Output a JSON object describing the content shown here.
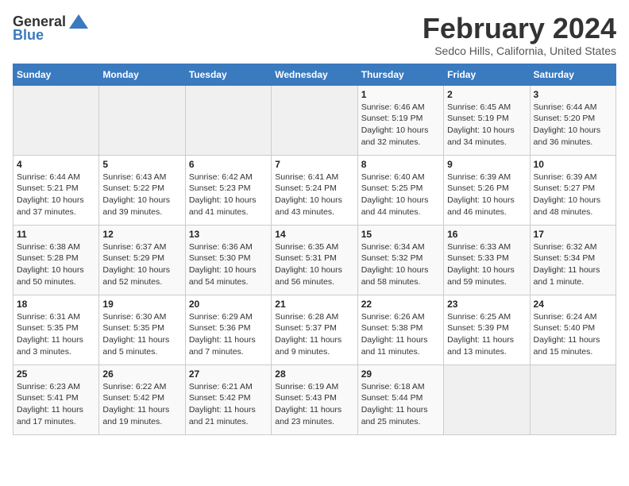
{
  "header": {
    "logo_general": "General",
    "logo_blue": "Blue",
    "month_title": "February 2024",
    "location": "Sedco Hills, California, United States"
  },
  "weekdays": [
    "Sunday",
    "Monday",
    "Tuesday",
    "Wednesday",
    "Thursday",
    "Friday",
    "Saturday"
  ],
  "weeks": [
    [
      {
        "day": "",
        "sunrise": "",
        "sunset": "",
        "daylight": ""
      },
      {
        "day": "",
        "sunrise": "",
        "sunset": "",
        "daylight": ""
      },
      {
        "day": "",
        "sunrise": "",
        "sunset": "",
        "daylight": ""
      },
      {
        "day": "",
        "sunrise": "",
        "sunset": "",
        "daylight": ""
      },
      {
        "day": "1",
        "sunrise": "Sunrise: 6:46 AM",
        "sunset": "Sunset: 5:19 PM",
        "daylight": "Daylight: 10 hours and 32 minutes."
      },
      {
        "day": "2",
        "sunrise": "Sunrise: 6:45 AM",
        "sunset": "Sunset: 5:19 PM",
        "daylight": "Daylight: 10 hours and 34 minutes."
      },
      {
        "day": "3",
        "sunrise": "Sunrise: 6:44 AM",
        "sunset": "Sunset: 5:20 PM",
        "daylight": "Daylight: 10 hours and 36 minutes."
      }
    ],
    [
      {
        "day": "4",
        "sunrise": "Sunrise: 6:44 AM",
        "sunset": "Sunset: 5:21 PM",
        "daylight": "Daylight: 10 hours and 37 minutes."
      },
      {
        "day": "5",
        "sunrise": "Sunrise: 6:43 AM",
        "sunset": "Sunset: 5:22 PM",
        "daylight": "Daylight: 10 hours and 39 minutes."
      },
      {
        "day": "6",
        "sunrise": "Sunrise: 6:42 AM",
        "sunset": "Sunset: 5:23 PM",
        "daylight": "Daylight: 10 hours and 41 minutes."
      },
      {
        "day": "7",
        "sunrise": "Sunrise: 6:41 AM",
        "sunset": "Sunset: 5:24 PM",
        "daylight": "Daylight: 10 hours and 43 minutes."
      },
      {
        "day": "8",
        "sunrise": "Sunrise: 6:40 AM",
        "sunset": "Sunset: 5:25 PM",
        "daylight": "Daylight: 10 hours and 44 minutes."
      },
      {
        "day": "9",
        "sunrise": "Sunrise: 6:39 AM",
        "sunset": "Sunset: 5:26 PM",
        "daylight": "Daylight: 10 hours and 46 minutes."
      },
      {
        "day": "10",
        "sunrise": "Sunrise: 6:39 AM",
        "sunset": "Sunset: 5:27 PM",
        "daylight": "Daylight: 10 hours and 48 minutes."
      }
    ],
    [
      {
        "day": "11",
        "sunrise": "Sunrise: 6:38 AM",
        "sunset": "Sunset: 5:28 PM",
        "daylight": "Daylight: 10 hours and 50 minutes."
      },
      {
        "day": "12",
        "sunrise": "Sunrise: 6:37 AM",
        "sunset": "Sunset: 5:29 PM",
        "daylight": "Daylight: 10 hours and 52 minutes."
      },
      {
        "day": "13",
        "sunrise": "Sunrise: 6:36 AM",
        "sunset": "Sunset: 5:30 PM",
        "daylight": "Daylight: 10 hours and 54 minutes."
      },
      {
        "day": "14",
        "sunrise": "Sunrise: 6:35 AM",
        "sunset": "Sunset: 5:31 PM",
        "daylight": "Daylight: 10 hours and 56 minutes."
      },
      {
        "day": "15",
        "sunrise": "Sunrise: 6:34 AM",
        "sunset": "Sunset: 5:32 PM",
        "daylight": "Daylight: 10 hours and 58 minutes."
      },
      {
        "day": "16",
        "sunrise": "Sunrise: 6:33 AM",
        "sunset": "Sunset: 5:33 PM",
        "daylight": "Daylight: 10 hours and 59 minutes."
      },
      {
        "day": "17",
        "sunrise": "Sunrise: 6:32 AM",
        "sunset": "Sunset: 5:34 PM",
        "daylight": "Daylight: 11 hours and 1 minute."
      }
    ],
    [
      {
        "day": "18",
        "sunrise": "Sunrise: 6:31 AM",
        "sunset": "Sunset: 5:35 PM",
        "daylight": "Daylight: 11 hours and 3 minutes."
      },
      {
        "day": "19",
        "sunrise": "Sunrise: 6:30 AM",
        "sunset": "Sunset: 5:35 PM",
        "daylight": "Daylight: 11 hours and 5 minutes."
      },
      {
        "day": "20",
        "sunrise": "Sunrise: 6:29 AM",
        "sunset": "Sunset: 5:36 PM",
        "daylight": "Daylight: 11 hours and 7 minutes."
      },
      {
        "day": "21",
        "sunrise": "Sunrise: 6:28 AM",
        "sunset": "Sunset: 5:37 PM",
        "daylight": "Daylight: 11 hours and 9 minutes."
      },
      {
        "day": "22",
        "sunrise": "Sunrise: 6:26 AM",
        "sunset": "Sunset: 5:38 PM",
        "daylight": "Daylight: 11 hours and 11 minutes."
      },
      {
        "day": "23",
        "sunrise": "Sunrise: 6:25 AM",
        "sunset": "Sunset: 5:39 PM",
        "daylight": "Daylight: 11 hours and 13 minutes."
      },
      {
        "day": "24",
        "sunrise": "Sunrise: 6:24 AM",
        "sunset": "Sunset: 5:40 PM",
        "daylight": "Daylight: 11 hours and 15 minutes."
      }
    ],
    [
      {
        "day": "25",
        "sunrise": "Sunrise: 6:23 AM",
        "sunset": "Sunset: 5:41 PM",
        "daylight": "Daylight: 11 hours and 17 minutes."
      },
      {
        "day": "26",
        "sunrise": "Sunrise: 6:22 AM",
        "sunset": "Sunset: 5:42 PM",
        "daylight": "Daylight: 11 hours and 19 minutes."
      },
      {
        "day": "27",
        "sunrise": "Sunrise: 6:21 AM",
        "sunset": "Sunset: 5:42 PM",
        "daylight": "Daylight: 11 hours and 21 minutes."
      },
      {
        "day": "28",
        "sunrise": "Sunrise: 6:19 AM",
        "sunset": "Sunset: 5:43 PM",
        "daylight": "Daylight: 11 hours and 23 minutes."
      },
      {
        "day": "29",
        "sunrise": "Sunrise: 6:18 AM",
        "sunset": "Sunset: 5:44 PM",
        "daylight": "Daylight: 11 hours and 25 minutes."
      },
      {
        "day": "",
        "sunrise": "",
        "sunset": "",
        "daylight": ""
      },
      {
        "day": "",
        "sunrise": "",
        "sunset": "",
        "daylight": ""
      }
    ]
  ]
}
